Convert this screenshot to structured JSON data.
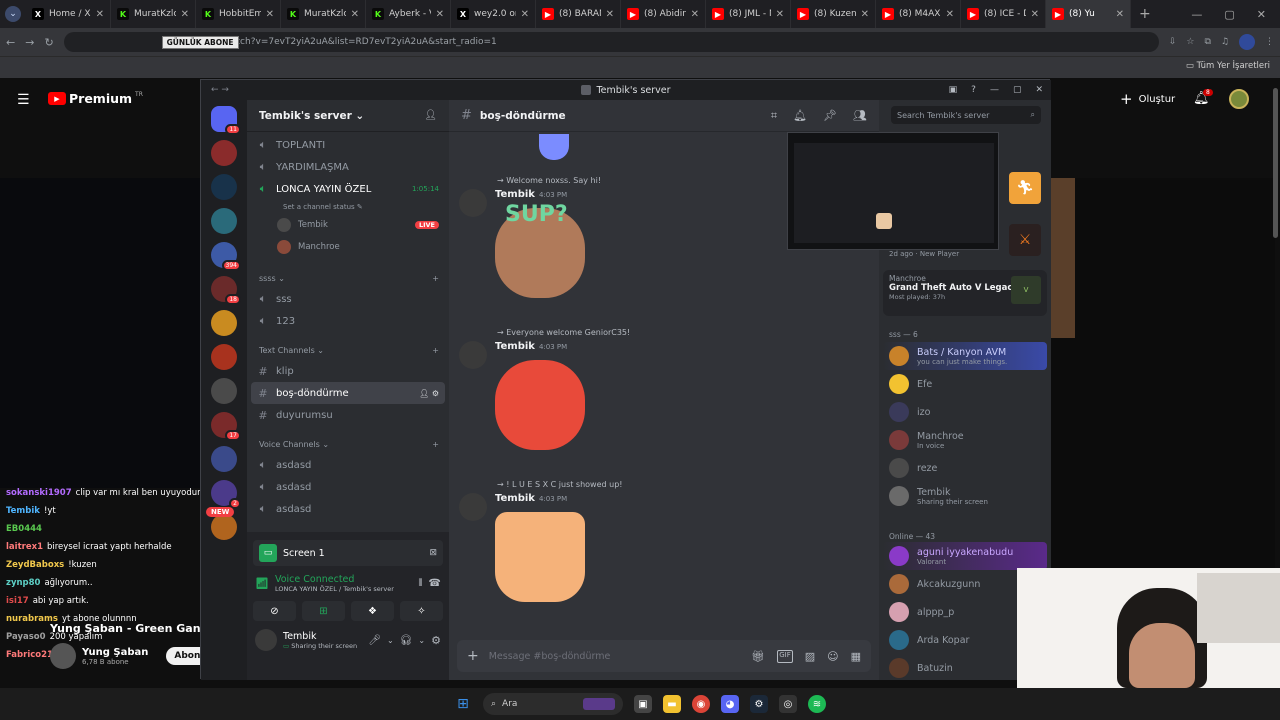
{
  "browser": {
    "tabs": [
      {
        "label": "Home / X",
        "icon": "x-icon",
        "color": "#000000"
      },
      {
        "label": "MuratKzlc",
        "icon": "kick-icon",
        "color": "#53fc18"
      },
      {
        "label": "HobbitEm",
        "icon": "kick-icon",
        "color": "#53fc18"
      },
      {
        "label": "MuratKzlc",
        "icon": "kick-icon",
        "color": "#53fc18"
      },
      {
        "label": "Ayberk - V",
        "icon": "kick-icon",
        "color": "#53fc18"
      },
      {
        "label": "wey2.0 on",
        "icon": "x-icon",
        "color": "#000000"
      },
      {
        "label": "(8) BARAN",
        "icon": "youtube-icon",
        "color": "#ff0000"
      },
      {
        "label": "(8) Abidin",
        "icon": "youtube-icon",
        "color": "#ff0000"
      },
      {
        "label": "(8) JML - N",
        "icon": "youtube-icon",
        "color": "#ff0000"
      },
      {
        "label": "(8) Kuzeni",
        "icon": "youtube-icon",
        "color": "#ff0000"
      },
      {
        "label": "(8) M4AXE",
        "icon": "youtube-icon",
        "color": "#ff0000"
      },
      {
        "label": "(8) ICE - D",
        "icon": "youtube-icon",
        "color": "#ff0000"
      },
      {
        "label": "(8) Yu",
        "icon": "youtube-icon",
        "color": "#ff0000",
        "active": true
      }
    ],
    "url": "watch?v=7evT2yiA2uA&list=RD7evT2yiA2uA&start_radio=1",
    "overlay_label": "GÜNLÜK ABONE",
    "bookmarks_label": "Tüm Yer İşaretleri"
  },
  "youtube": {
    "logo_text": "Premium",
    "region": "TR",
    "create_label": "Oluştur",
    "notif_count": "8",
    "channel_name": "Yung Şaban",
    "subs": "6,78 B abone",
    "subscribe_label": "Abone",
    "video_title": "Yung Şaban - Green Gang",
    "chat": [
      {
        "user": "sokanski1907",
        "text": "clip var mı kral ben uyuyodum",
        "color": "#b36bff"
      },
      {
        "user": "Tembik",
        "text": "!yt",
        "color": "#4fb5ff"
      },
      {
        "user": "EB0444",
        "text": "",
        "color": "#59c94f"
      },
      {
        "user": "laitrex1",
        "text": "bireysel icraat yaptı herhalde",
        "color": "#ff7a7a"
      },
      {
        "user": "ZeydBaboxs",
        "text": "!kuzen",
        "color": "#f2c94c"
      },
      {
        "user": "zynp80",
        "text": "ağlıyorum..",
        "color": "#5dd0c6"
      },
      {
        "user": "isi17",
        "text": "abi yap artık.",
        "color": "#e04b4b"
      },
      {
        "user": "nurabrams",
        "text": "yt abone olunnnn",
        "color": "#f2c94c"
      },
      {
        "user": "Payaso0",
        "text": "200 yapalım",
        "color": "#a0a0a0"
      },
      {
        "user": "Fabrico21",
        "text": "",
        "color": "#ff7a7a"
      }
    ]
  },
  "discord": {
    "window_title": "Tembik's server",
    "server_name": "Tembik's server",
    "guild_badges": [
      "11",
      "",
      "",
      "",
      "394",
      "18",
      "",
      "",
      "",
      "17",
      "",
      "2",
      ""
    ],
    "new_label": "NEW",
    "voice_top": [
      {
        "name": "TOPLANTI"
      },
      {
        "name": "YARDIMLAŞMA"
      },
      {
        "name": "LONCA YAYIN ÖZEL",
        "time": "1:05:14"
      }
    ],
    "channel_status": "Set a channel status",
    "voice_users": [
      {
        "name": "Tembik",
        "live": "LIVE"
      },
      {
        "name": "Manchroe"
      }
    ],
    "cat_ssss": "ssss",
    "ssss_channels": [
      "sss",
      "123"
    ],
    "cat_text": "Text Channels",
    "text_channels": [
      "klip",
      "boş-döndürme",
      "duyurumsu"
    ],
    "cat_voice": "Voice Channels",
    "voice_channels": [
      "asdasd",
      "asdasd",
      "asdasd"
    ],
    "stream_panel": {
      "label": "Screen 1"
    },
    "voice_connected": "Voice Connected",
    "voice_location": "LONCA YAYIN ÖZEL / Tembik's server",
    "user": {
      "name": "Tembik",
      "status": "Sharing their screen"
    },
    "current_channel": "boş-döndürme",
    "search_placeholder": "Search Tembik's server",
    "messages": [
      {
        "system": "Welcome noxss. Say hi!",
        "author": "Tembik",
        "time": "4:03 PM",
        "sticker": "SUP?"
      },
      {
        "system": "Everyone welcome GeniorC35!",
        "author": "Tembik",
        "time": "4:03 PM"
      },
      {
        "system": "! L U E S X C just showed up!",
        "author": "Tembik",
        "time": "4:03 PM"
      }
    ],
    "composer_placeholder": "Message #boş-döndürme",
    "members": {
      "activity_top": "2d ago",
      "activity_new": "New Player",
      "activity_user": "Manchroe",
      "activity_game": "Grand Theft Auto V Legacy",
      "activity_played": "Most played: 37h",
      "role_header": "sss — 6",
      "role_members": [
        {
          "name": "Bats / Kanyon AVM",
          "status": "you can just make things.",
          "color": "#c9cdfb"
        },
        {
          "name": "Efe",
          "status": "",
          "color": "#949ba4"
        },
        {
          "name": "izo",
          "status": "",
          "color": "#949ba4"
        },
        {
          "name": "Manchroe",
          "status": "In voice",
          "color": "#949ba4"
        },
        {
          "name": "reze",
          "status": "",
          "color": "#949ba4"
        },
        {
          "name": "Tembik",
          "status": "Sharing their screen",
          "color": "#949ba4"
        }
      ],
      "online_header": "Online — 43",
      "online_members": [
        {
          "name": "aguni iyyakenabudu",
          "status": "Valorant",
          "color": "#c9a7ff"
        },
        {
          "name": "Akcakuzgunn",
          "status": "",
          "color": "#949ba4"
        },
        {
          "name": "alppp_p",
          "status": "",
          "color": "#949ba4"
        },
        {
          "name": "Arda Kopar",
          "status": "",
          "color": "#949ba4"
        },
        {
          "name": "Batuzin",
          "status": "",
          "color": "#949ba4"
        }
      ]
    }
  },
  "taskbar": {
    "search_label": "Ara"
  }
}
